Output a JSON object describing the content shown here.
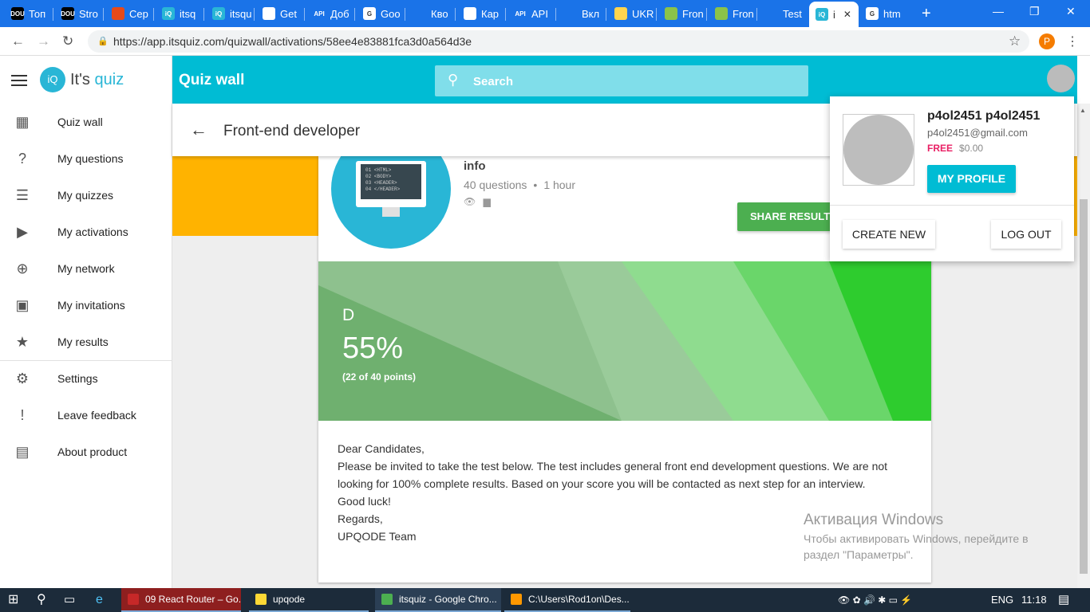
{
  "browser": {
    "tabs": [
      {
        "label": "Топ",
        "icon": "DOU",
        "color": "#000000"
      },
      {
        "label": "Stro",
        "icon": "DOU",
        "color": "#000000"
      },
      {
        "label": "Сер",
        "icon": "",
        "color": "#e64a19"
      },
      {
        "label": "itsq",
        "icon": "iQ",
        "color": "#29b6d6"
      },
      {
        "label": "itsqu",
        "icon": "iQ",
        "color": "#29b6d6"
      },
      {
        "label": "Get",
        "icon": "",
        "color": "#ffffff"
      },
      {
        "label": "Доб",
        "icon": "API",
        "color": "#1a73e8"
      },
      {
        "label": "Goo",
        "icon": "G",
        "color": "#ffffff"
      },
      {
        "label": "Кво",
        "icon": "",
        "color": "#1a73e8"
      },
      {
        "label": "Кар",
        "icon": "",
        "color": "#ffffff"
      },
      {
        "label": "API",
        "icon": "API",
        "color": "#1a73e8"
      },
      {
        "label": "Вкл",
        "icon": "",
        "color": "#1a73e8"
      },
      {
        "label": "UKR",
        "icon": "",
        "color": "#ffd54f"
      },
      {
        "label": "Fron",
        "icon": "",
        "color": "#8bc34a"
      },
      {
        "label": "Fron",
        "icon": "",
        "color": "#8bc34a"
      },
      {
        "label": "Test",
        "icon": "",
        "color": "#1a73e8"
      },
      {
        "label": "i",
        "icon": "iQ",
        "color": "#29b6d6",
        "active": true
      },
      {
        "label": "htm",
        "icon": "G",
        "color": "#ffffff"
      }
    ],
    "new_tab": "+",
    "url": "https://app.itsquiz.com/quizwall/activations/58ee4e83881fca3d0a564d3e",
    "profile_initial": "P"
  },
  "sidebar": {
    "logo_text": "It's",
    "logo_accent": "quiz",
    "logo_badge": "iQ",
    "items": [
      {
        "label": "Quiz wall",
        "icon": "dashboard-icon",
        "glyph": "▦"
      },
      {
        "label": "My questions",
        "icon": "help-icon",
        "glyph": "?"
      },
      {
        "label": "My quizzes",
        "icon": "list-icon",
        "glyph": "☰"
      },
      {
        "label": "My activations",
        "icon": "play-icon",
        "glyph": "▶"
      },
      {
        "label": "My network",
        "icon": "globe-icon",
        "glyph": "⊕"
      },
      {
        "label": "My invitations",
        "icon": "inbox-icon",
        "glyph": "▣"
      },
      {
        "label": "My results",
        "icon": "star-icon",
        "glyph": "★"
      },
      {
        "label": "Settings",
        "icon": "gear-icon",
        "glyph": "⚙"
      },
      {
        "label": "Leave feedback",
        "icon": "feedback-icon",
        "glyph": "!"
      },
      {
        "label": "About product",
        "icon": "clipboard-icon",
        "glyph": "▤"
      }
    ]
  },
  "header": {
    "title": "Quiz wall",
    "search_placeholder": "Search"
  },
  "subheader": {
    "title": "Front-end developer"
  },
  "quiz": {
    "code_lines": [
      "01 <HTML>",
      "02 <BODY>",
      "03 <HEADER>",
      "04 </HEADER>"
    ],
    "info": "info",
    "questions": "40 questions",
    "duration": "1 hour",
    "share_label": "SHARE RESULT",
    "grade": "D",
    "percent": "55%",
    "points": "(22 of 40 points)",
    "description": [
      "Dear Candidates,",
      "Please be invited to take the test below.  The test includes general front end development questions. We are not looking for 100% complete results. Based on your score you will be contacted as next step for an interview.",
      "Good luck!",
      "Regards,",
      "UPQODE Team"
    ]
  },
  "profile_popup": {
    "name": "p4ol2451 p4ol2451",
    "email": "p4ol2451@gmail.com",
    "plan": "FREE",
    "balance": "$0.00",
    "my_profile": "MY PROFILE",
    "create_new": "CREATE NEW",
    "log_out": "LOG OUT"
  },
  "watermark": {
    "title": "Активация Windows",
    "line1": "Чтобы активировать Windows, перейдите в",
    "line2": "раздел \"Параметры\"."
  },
  "taskbar": {
    "items": [
      {
        "label": "09 React Router – Go...",
        "color": "#c62828"
      },
      {
        "label": "upqode",
        "color": "#fdd835"
      },
      {
        "label": "itsquiz - Google Chro...",
        "color": "#4caf50"
      },
      {
        "label": "C:\\Users\\Rod1on\\Des...",
        "color": "#ff9800"
      }
    ],
    "lang": "ENG",
    "time": "11:18"
  },
  "colors": {
    "accent": "#00bcd4",
    "share_green": "#4caf50",
    "free_pink": "#e91e63",
    "banner_orange": "#ffb300"
  }
}
